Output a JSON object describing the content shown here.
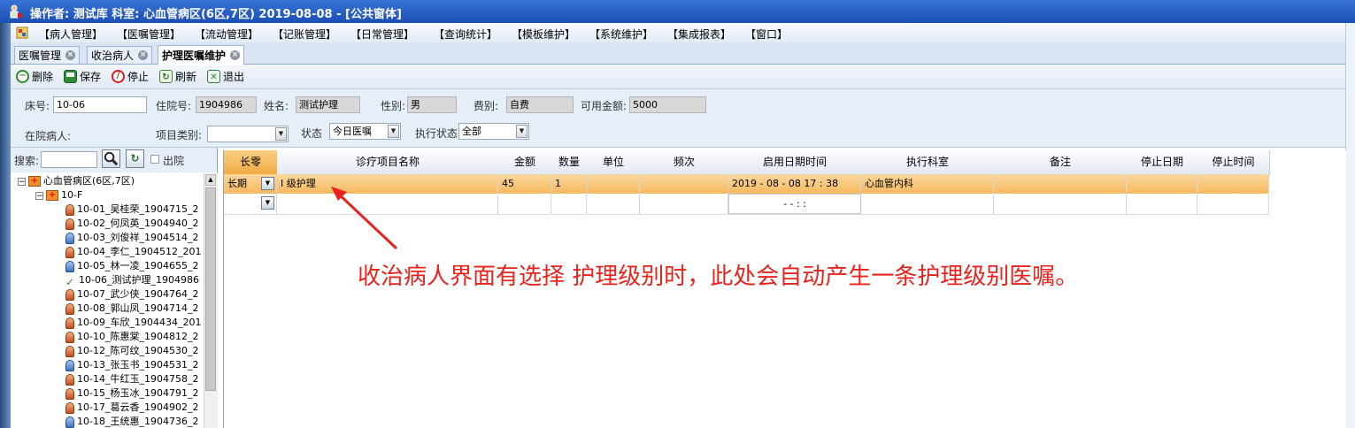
{
  "window": {
    "title": "操作者: 测试库   科室: 心血管病区(6区,7区)   2019-08-08 - [公共窗体]"
  },
  "menu": {
    "items": [
      "【病人管理】",
      "【医嘱管理】",
      "【流动管理】",
      "【记账管理】",
      "【日常管理】",
      "【查询统计】",
      "【模板维护】",
      "【系统维护】",
      "【集成报表】",
      "【窗口】"
    ]
  },
  "tabs": [
    {
      "label": "医嘱管理"
    },
    {
      "label": "收治病人"
    },
    {
      "label": "护理医嘱维护"
    }
  ],
  "toolbar": {
    "delete": "删除",
    "save": "保存",
    "stop": "停止",
    "refresh": "刷新",
    "exit": "退出"
  },
  "form": {
    "bed_label": "床号:",
    "bed_value": "10-06",
    "admission_label": "住院号:",
    "admission_value": "1904986",
    "name_label": "姓名:",
    "name_value": "测试护理",
    "gender_label": "性别:",
    "gender_value": "男",
    "fee_label": "费别:",
    "fee_value": "自费",
    "balance_label": "可用金额:",
    "balance_value": "5000",
    "inpatient_label": "在院病人:",
    "category_label": "项目类别:",
    "category_value": "",
    "status_label": "状态",
    "status_value": "今日医嘱",
    "exec_status_label": "执行状态",
    "exec_status_value": "全部"
  },
  "sidebar": {
    "search_label": "搜索:",
    "search_value": "",
    "discharged_label": "出院",
    "root": "心血管病区(6区,7区)",
    "group": "10-F",
    "patients": [
      {
        "label": "10-01_吴桂荣_1904715_2",
        "sex": "f"
      },
      {
        "label": "10-02_何凤英_1904940_2",
        "sex": "f"
      },
      {
        "label": "10-03_刘俊祥_1904514_2",
        "sex": "m"
      },
      {
        "label": "10-04_李仁_1904512_201",
        "sex": "f"
      },
      {
        "label": "10-05_林一凌_1904655_2",
        "sex": "m"
      },
      {
        "label": "10-06_测试护理_1904986",
        "sex": "c"
      },
      {
        "label": "10-07_武少侠_1904764_2",
        "sex": "f"
      },
      {
        "label": "10-08_郭山凤_1904714_2",
        "sex": "f"
      },
      {
        "label": "10-09_车欣_1904434_201",
        "sex": "f"
      },
      {
        "label": "10-10_陈惠棠_1904812_2",
        "sex": "f"
      },
      {
        "label": "10-12_陈可纹_1904530_2",
        "sex": "f"
      },
      {
        "label": "10-13_张玉书_1904531_2",
        "sex": "m"
      },
      {
        "label": "10-14_牛红玉_1904758_2",
        "sex": "f"
      },
      {
        "label": "10-15_杨玉冰_1904791_2",
        "sex": "f"
      },
      {
        "label": "10-17_葛云香_1904902_2",
        "sex": "f"
      },
      {
        "label": "10-18_王统惠_1904736_2",
        "sex": "m"
      }
    ]
  },
  "grid": {
    "headers": [
      "长零",
      "诊疗项目名称",
      "金额",
      "数量",
      "单位",
      "频次",
      "启用日期时间",
      "执行科室",
      "备注",
      "停止日期",
      "停止时间"
    ],
    "rows": [
      {
        "type": "长期",
        "item": "I 级护理",
        "amount": "45",
        "qty": "1",
        "unit": "",
        "freq": "",
        "start": "2019 - 08 - 08    17 : 38",
        "dept": "心血管内科",
        "note": "",
        "stop_date": "",
        "stop_time": ""
      },
      {
        "type": "",
        "item": "",
        "amount": "",
        "qty": "",
        "unit": "",
        "freq": "",
        "start": "-    -          :    :",
        "dept": "",
        "note": "",
        "stop_date": "",
        "stop_time": ""
      }
    ]
  },
  "annotation": {
    "text": "收治病人界面有选择 护理级别时，此处会自动产生一条护理级别医嘱。"
  },
  "colors": {
    "title_bar": "#1a4fb4",
    "selected_row": "#f6b95e",
    "annotation": "#e8231d"
  }
}
